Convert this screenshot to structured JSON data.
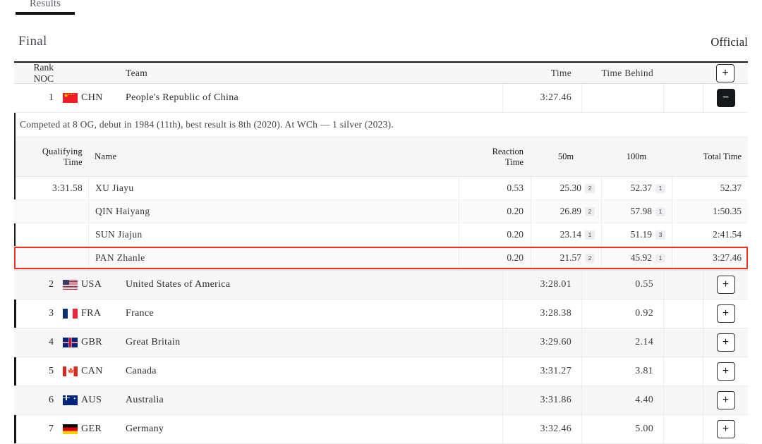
{
  "tabs": {
    "active_label": "Results"
  },
  "section": {
    "title": "Final",
    "status": "Official"
  },
  "table": {
    "headers": {
      "rank_noc": "Rank NOC",
      "team": "Team",
      "time": "Time",
      "time_behind": "Time Behind",
      "expand_all": "+"
    },
    "rows": [
      {
        "rank": "1",
        "noc": "CHN",
        "flag": "flag-chn",
        "team": "People's Republic of China",
        "time": "3:27.46",
        "behind": "",
        "button": "−",
        "expanded": true
      },
      {
        "rank": "2",
        "noc": "USA",
        "flag": "flag-usa",
        "team": "United States of America",
        "time": "3:28.01",
        "behind": "0.55",
        "button": "+",
        "expanded": false
      },
      {
        "rank": "3",
        "noc": "FRA",
        "flag": "flag-fra",
        "team": "France",
        "time": "3:28.38",
        "behind": "0.92",
        "button": "+",
        "expanded": false
      },
      {
        "rank": "4",
        "noc": "GBR",
        "flag": "flag-gbr",
        "team": "Great Britain",
        "time": "3:29.60",
        "behind": "2.14",
        "button": "+",
        "expanded": false
      },
      {
        "rank": "5",
        "noc": "CAN",
        "flag": "flag-can",
        "team": "Canada",
        "time": "3:31.27",
        "behind": "3.81",
        "button": "+",
        "expanded": false
      },
      {
        "rank": "6",
        "noc": "AUS",
        "flag": "flag-aus",
        "team": "Australia",
        "time": "3:31.86",
        "behind": "4.40",
        "button": "+",
        "expanded": false
      },
      {
        "rank": "7",
        "noc": "GER",
        "flag": "flag-ger",
        "team": "Germany",
        "time": "3:32.46",
        "behind": "5.00",
        "button": "+",
        "expanded": false
      }
    ]
  },
  "detail": {
    "note": "Competed at 8 OG, debut in 1984 (11th), best result is 8th (2020). At WCh — 1 silver (2023).",
    "headers": {
      "qualifying_top": "Qualifying",
      "qualifying_bottom": "Time",
      "name": "Name",
      "reaction_top": "Reaction",
      "reaction_bottom": "Time",
      "split_50m": "50m",
      "split_100m": "100m",
      "total_time": "Total Time"
    },
    "legs": [
      {
        "qualifying": "3:31.58",
        "name": "XU Jiayu",
        "reaction": "0.53",
        "s50": "25.30",
        "s50_rank": "2",
        "s100": "52.37",
        "s100_rank": "1",
        "total": "52.37",
        "highlighted": false
      },
      {
        "qualifying": "",
        "name": "QIN Haiyang",
        "reaction": "0.20",
        "s50": "26.89",
        "s50_rank": "2",
        "s100": "57.98",
        "s100_rank": "1",
        "total": "1:50.35",
        "highlighted": false
      },
      {
        "qualifying": "",
        "name": "SUN Jiajun",
        "reaction": "0.20",
        "s50": "23.14",
        "s50_rank": "1",
        "s100": "51.19",
        "s100_rank": "3",
        "total": "2:41.54",
        "highlighted": false
      },
      {
        "qualifying": "",
        "name": "PAN Zhanle",
        "reaction": "0.20",
        "s50": "21.57",
        "s50_rank": "2",
        "s100": "45.92",
        "s100_rank": "1",
        "total": "3:27.46",
        "highlighted": true
      }
    ]
  },
  "colors": {
    "highlight": "#ef3124",
    "accent": "#15181c",
    "shade": "#f7f7f8"
  }
}
